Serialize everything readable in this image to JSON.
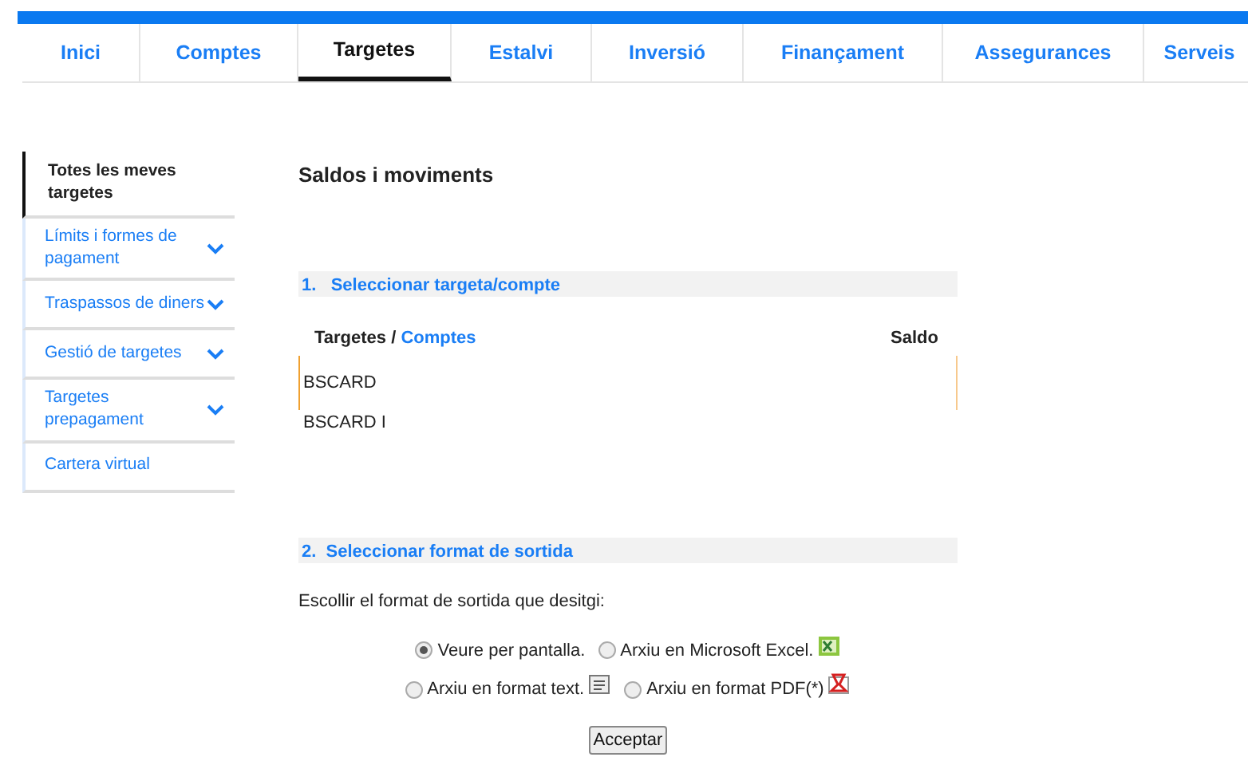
{
  "tabs": [
    {
      "label": "Inici",
      "selected": false
    },
    {
      "label": "Comptes",
      "selected": false
    },
    {
      "label": "Targetes",
      "selected": true
    },
    {
      "label": "Estalvi",
      "selected": false
    },
    {
      "label": "Inversió",
      "selected": false
    },
    {
      "label": "Finançament",
      "selected": false
    },
    {
      "label": "Assegurances",
      "selected": false
    },
    {
      "label": "Serveis",
      "selected": false
    }
  ],
  "sidebar": {
    "items": [
      {
        "label": "Totes les meves targetes",
        "selected": true,
        "expandable": false
      },
      {
        "label": "Límits i formes de pagament",
        "selected": false,
        "expandable": true
      },
      {
        "label": "Traspassos de diners",
        "selected": false,
        "expandable": true
      },
      {
        "label": "Gestió de targetes",
        "selected": false,
        "expandable": true
      },
      {
        "label": "Targetes prepagament",
        "selected": false,
        "expandable": true
      },
      {
        "label": "Cartera virtual",
        "selected": false,
        "expandable": false
      }
    ]
  },
  "title": "Saldos i moviments",
  "section_1": {
    "number": "1.",
    "title": "Seleccionar targeta/compte",
    "columns": {
      "first": "Targetes",
      "separator": "/",
      "link": "Comptes",
      "balance": "Saldo"
    },
    "rows": [
      {
        "name": "BSCARD",
        "selected": true
      },
      {
        "name": "BSCARD I",
        "selected": false
      }
    ]
  },
  "section_2": {
    "number": "2.",
    "title": "Seleccionar format de sortida",
    "prompt": "Escollir el format de sortida que desitgi:",
    "option_rows": [
      [
        {
          "label": "Veure per pantalla.",
          "selected": true,
          "kind": "none"
        },
        {
          "label": "Arxiu en Microsoft Excel.",
          "selected": false,
          "kind": "excel"
        }
      ],
      [
        {
          "label": "Arxiu en format text.",
          "selected": false,
          "kind": "text"
        },
        {
          "label": "Arxiu en format PDF(*)",
          "selected": false,
          "kind": "pdf"
        }
      ]
    ],
    "button": "Acceptar"
  }
}
